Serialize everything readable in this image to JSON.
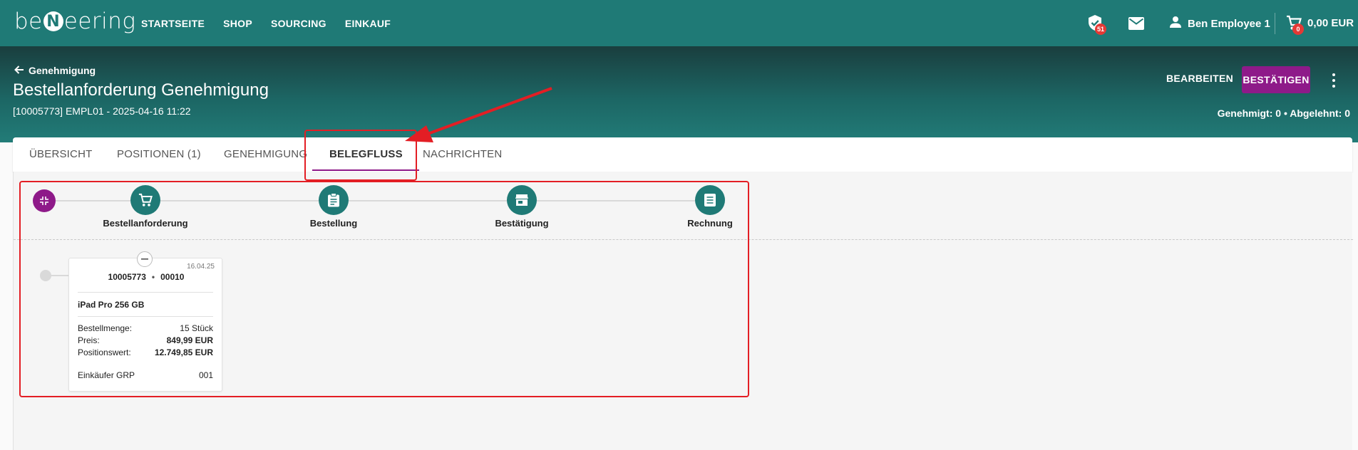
{
  "header": {
    "logo_text_left": "be",
    "logo_mark": "N",
    "logo_text_right": "eering",
    "nav": [
      "STARTSEITE",
      "SHOP",
      "SOURCING",
      "EINKAUF"
    ],
    "approvals_badge": "51",
    "user_name": "Ben Employee 1",
    "cart_badge": "0",
    "cart_total": "0,00 EUR",
    "icons": [
      "approval-check-icon",
      "mail-icon",
      "user-icon",
      "cart-icon"
    ]
  },
  "subheader": {
    "back_label": "Genehmigung",
    "title": "Bestellanforderung Genehmigung",
    "subtitle": "[10005773] EMPL01 - 2025-04-16 11:22",
    "edit_label": "BEARBEITEN",
    "confirm_label": "BESTÄTIGEN",
    "counts": "Genehmigt: 0 • Abgelehnt: 0"
  },
  "tabs": [
    {
      "label": "ÜBERSICHT"
    },
    {
      "label": "POSITIONEN (1)"
    },
    {
      "label": "GENEHMIGUNG"
    },
    {
      "label": "BELEGFLUSS"
    },
    {
      "label": "NACHRICHTEN"
    }
  ],
  "active_tab": "BELEGFLUSS",
  "flow": {
    "stages": [
      {
        "label": "Bestellanforderung",
        "icon": "cart-icon"
      },
      {
        "label": "Bestellung",
        "icon": "clipboard-icon"
      },
      {
        "label": "Bestätigung",
        "icon": "store-icon"
      },
      {
        "label": "Rechnung",
        "icon": "document-icon"
      }
    ]
  },
  "item_card": {
    "date": "16.04.25",
    "doc_number": "10005773",
    "position": "00010",
    "name": "iPad Pro 256 GB",
    "rows": [
      {
        "label": "Bestellmenge:",
        "value": "15 Stück"
      },
      {
        "label": "Preis:",
        "value": "849,99 EUR"
      },
      {
        "label": "Positionswert:",
        "value": "12.749,85 EUR"
      },
      {
        "label": "Einkäufer GRP",
        "value": "001"
      }
    ]
  },
  "colors": {
    "primary_teal": "#1f7a76",
    "accent_purple": "#8e1a89",
    "badge_red": "#e53935",
    "annotation_red": "#e31e24"
  }
}
